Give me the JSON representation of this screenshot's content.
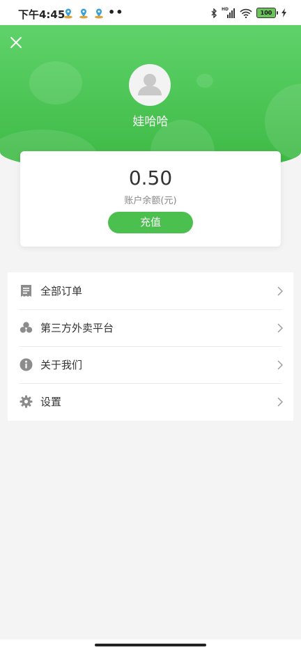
{
  "status_bar": {
    "time": "下午4:45",
    "network_label": "HD",
    "battery_level": "100",
    "app_icons": [
      "map-pin-icon",
      "map-pin-icon",
      "map-pin-icon"
    ],
    "system_icons": [
      "bluetooth-icon",
      "signal-icon",
      "wifi-icon",
      "battery-icon",
      "charging-icon"
    ]
  },
  "header": {
    "username": "娃哈哈",
    "background_color": "#4cc04f"
  },
  "balance": {
    "value": "0.50",
    "label": "账户余额(元)",
    "recharge_label": "充值"
  },
  "menu": {
    "items": [
      {
        "label": "全部订单",
        "icon": "receipt-icon"
      },
      {
        "label": "第三方外卖平台",
        "icon": "clover-icon"
      },
      {
        "label": "关于我们",
        "icon": "info-icon"
      },
      {
        "label": "设置",
        "icon": "gear-icon"
      }
    ]
  },
  "colors": {
    "accent": "#4cc04f",
    "icon_gray": "#8c8c8c",
    "page_bg": "#f4f4f4"
  }
}
